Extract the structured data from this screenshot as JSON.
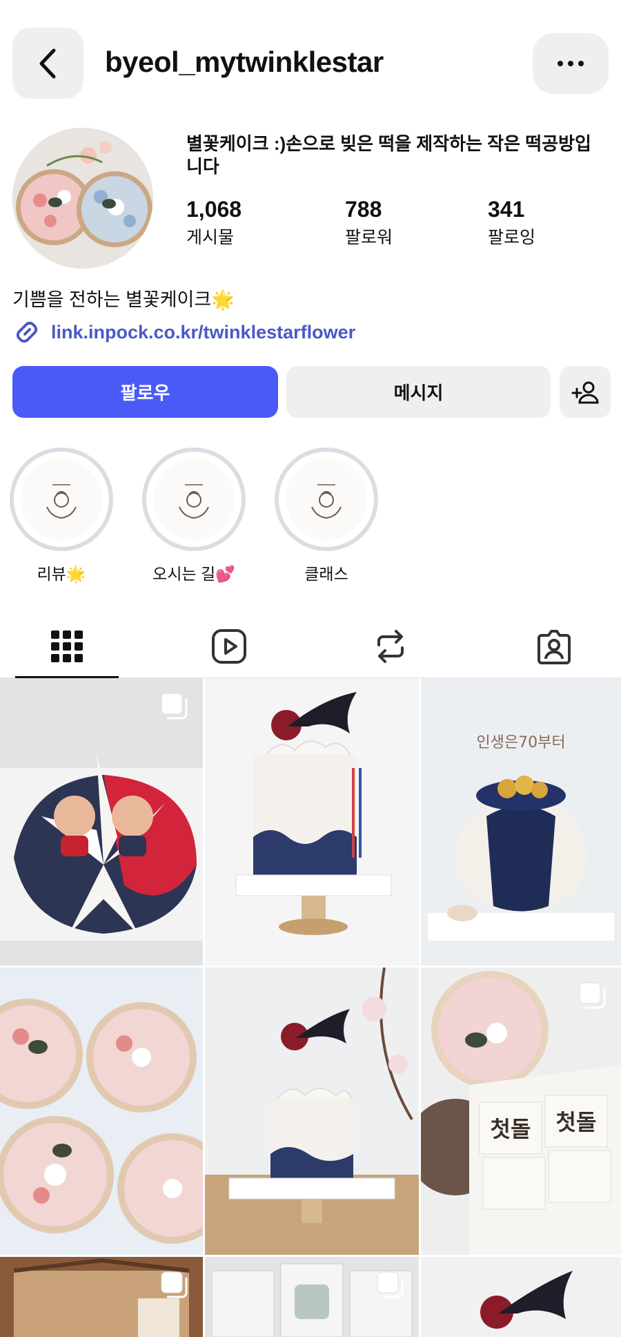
{
  "header": {
    "username": "byeol_mytwinklestar"
  },
  "profile": {
    "bio_title": "별꽃케이크 :)손으로 빚은 떡을 제작하는 작은 떡공방입니다",
    "stats": [
      {
        "value": "1,068",
        "label": "게시물"
      },
      {
        "value": "788",
        "label": "팔로워"
      },
      {
        "value": "341",
        "label": "팔로잉"
      }
    ],
    "bio_line": "기쁨을 전하는 별꽃케이크🌟",
    "link": "link.inpock.co.kr/twinklestarflower"
  },
  "actions": {
    "follow": "팔로우",
    "message": "메시지"
  },
  "highlights": [
    {
      "label": "리뷰🌟"
    },
    {
      "label": "오시는 길💕"
    },
    {
      "label": "클래스"
    }
  ],
  "tabs": [
    "grid-icon",
    "reels-icon",
    "repost-icon",
    "tagged-icon"
  ],
  "colors": {
    "accent": "#4a5af7",
    "link": "#4a58c8",
    "button_bg": "#efefef"
  }
}
